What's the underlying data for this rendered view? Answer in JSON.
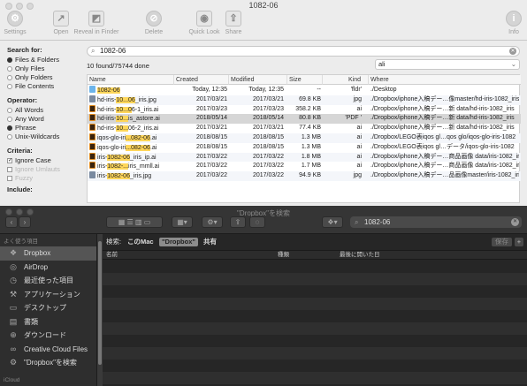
{
  "top_window": {
    "title": "1082-06",
    "toolbar": [
      {
        "label": "Settings",
        "icon": "gear-icon"
      },
      {
        "label": "Open",
        "icon": "open-document-icon"
      },
      {
        "label": "Reveal in Finder",
        "icon": "reveal-finder-icon"
      },
      {
        "label": "Delete",
        "icon": "delete-icon"
      },
      {
        "label": "Quick Look",
        "icon": "eye-icon"
      },
      {
        "label": "Share",
        "icon": "share-icon"
      },
      {
        "label": "Info",
        "icon": "info-icon"
      }
    ],
    "sidebar": {
      "search_for_label": "Search for:",
      "search_for": [
        "Files & Folders",
        "Only Files",
        "Only Folders",
        "File Contents"
      ],
      "operator_label": "Operator:",
      "operators": [
        "All Words",
        "Any Word",
        "Phrase",
        "Unix-Wildcards"
      ],
      "criteria_label": "Criteria:",
      "criteria": [
        "Ignore Case",
        "Ignore Umlauts",
        "Fuzzy"
      ],
      "include_label": "Include:"
    },
    "search_value": "1082-06",
    "status": "10 found/75744 done",
    "filter_value": "ali",
    "columns": [
      "Name",
      "Created",
      "Modified",
      "Size",
      "Kind",
      "Where"
    ],
    "rows": [
      {
        "name_pre": "",
        "name_hl": "1082-06",
        "name_post": "",
        "created": "Today, 12:35",
        "modified": "Today, 12:35",
        "size": "--",
        "kind": "'fldr'",
        "where": "./Desktop",
        "type": "folder"
      },
      {
        "name_pre": "hd-iris-",
        "name_hl": "10...06",
        "name_post": "_iris.jpg",
        "created": "2017/03/21",
        "modified": "2017/03/21",
        "size": "69.8 KB",
        "kind": "jpg",
        "where": "./Dropbox/iphone入稿デー…像master/hd-iris-1082_iris",
        "type": "jpg"
      },
      {
        "name_pre": "hd-iris-",
        "name_hl": "10...0",
        "name_post": "6-1_iris.ai",
        "created": "2017/03/23",
        "modified": "2017/03/23",
        "size": "358.2 KB",
        "kind": "ai",
        "where": "./Dropbox/iphone入稿デー…新 data/hd-iris-1082_iris",
        "type": "ai"
      },
      {
        "name_pre": "hd-iris-",
        "name_hl": "10...",
        "name_post": "is_astore.ai",
        "created": "2018/05/14",
        "modified": "2018/05/14",
        "size": "80.8 KB",
        "kind": "'PDF '",
        "where": "./Dropbox/iphone入稿デー…新 data/hd-iris-1082_iris",
        "type": "ai"
      },
      {
        "name_pre": "hd-iris-",
        "name_hl": "10...",
        "name_post": "06-2_iris.ai",
        "created": "2017/03/21",
        "modified": "2017/03/21",
        "size": "77.4 KB",
        "kind": "ai",
        "where": "./Dropbox/iphone入稿デー…新 data/hd-iris-1082_iris",
        "type": "ai"
      },
      {
        "name_pre": "iqos-glo-iri",
        "name_hl": "...082-06",
        "name_post": ".ai",
        "created": "2018/08/15",
        "modified": "2018/08/15",
        "size": "1.3 MB",
        "kind": "ai",
        "where": "./Dropbox/LEGO表iqos gl…qos glo/iqos-glo-iris-1082",
        "type": "ai"
      },
      {
        "name_pre": "iqos-glo-iri",
        "name_hl": "...082-06",
        "name_post": ".ai",
        "created": "2018/08/15",
        "modified": "2018/08/15",
        "size": "1.3 MB",
        "kind": "ai",
        "where": "./Dropbox/LEGO表iqos gl…データ/iqos-glo-iris-1082",
        "type": "ai"
      },
      {
        "name_pre": "iris-",
        "name_hl": "1082-06",
        "name_post": "_iris_ip.ai",
        "created": "2017/03/22",
        "modified": "2017/03/22",
        "size": "1.8 MB",
        "kind": "ai",
        "where": "./Dropbox/iphone入稿デー…商品画像 data/iris-1082_iris",
        "type": "ai"
      },
      {
        "name_pre": "iris-",
        "name_hl": "1082-...",
        "name_post": "iris_mmll.ai",
        "created": "2017/03/22",
        "modified": "2017/03/22",
        "size": "1.7 MB",
        "kind": "ai",
        "where": "./Dropbox/iphone入稿デー…商品画像 data/iris-1082_iris",
        "type": "ai"
      },
      {
        "name_pre": "iris-",
        "name_hl": "1082-06",
        "name_post": "_iris.jpg",
        "created": "2017/03/22",
        "modified": "2017/03/22",
        "size": "94.9 KB",
        "kind": "jpg",
        "where": "./Dropbox/iphone入稿デー…品画像master/iris-1082_iris",
        "type": "jpg"
      }
    ]
  },
  "bottom_window": {
    "title": "\"Dropbox\"を検索",
    "search_value": "1082-06",
    "favorites_label": "よく使う項目",
    "sidebar_items": [
      {
        "label": "Dropbox",
        "icon": "dropbox-icon"
      },
      {
        "label": "AirDrop",
        "icon": "airdrop-icon"
      },
      {
        "label": "最近使った項目",
        "icon": "recents-icon"
      },
      {
        "label": "アプリケーション",
        "icon": "applications-icon"
      },
      {
        "label": "デスクトップ",
        "icon": "desktop-icon"
      },
      {
        "label": "書類",
        "icon": "documents-icon"
      },
      {
        "label": "ダウンロード",
        "icon": "downloads-icon"
      },
      {
        "label": "Creative Cloud Files",
        "icon": "creative-cloud-icon"
      },
      {
        "label": "\"Dropbox\"を検索",
        "icon": "gear-icon"
      }
    ],
    "icloud_label": "iCloud",
    "scope_prefix": "検索:",
    "scope_mac": "このMac",
    "scope_dropbox": "\"Dropbox\"",
    "scope_shared": "共有",
    "save_label": "保存",
    "add_label": "+",
    "columns": [
      "名前",
      "種類",
      "最後に開いた日"
    ]
  }
}
